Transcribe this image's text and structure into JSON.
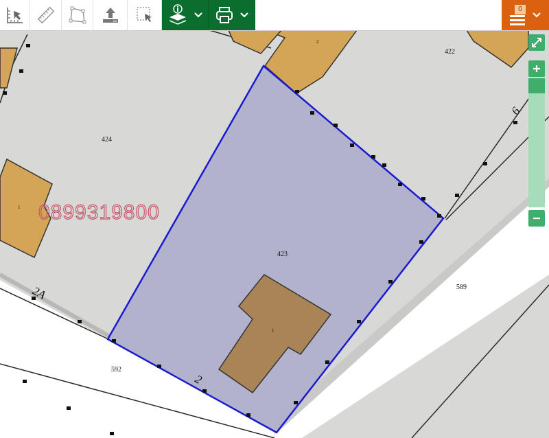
{
  "parcels": {
    "p424": "424",
    "p423": "423",
    "p422": "422",
    "p589": "589",
    "p592": "592"
  },
  "building_labels": {
    "b1_main": "1",
    "b1_left": "1",
    "b2_top": "2"
  },
  "street_numbers": {
    "n2a": "2A",
    "n2": "2",
    "n6": "6"
  },
  "watermark": "0899319800",
  "toolbar": {
    "badge_count": "0"
  },
  "colors": {
    "selected_parcel_fill": "#b0b0cc",
    "selected_parcel_stroke": "#1a1ad0",
    "building": "#d4a557",
    "selected_building": "#a88457",
    "toolbar_green": "#0b6e2e",
    "toolbar_orange": "#d9610f",
    "zoom_green": "#3fae6b",
    "watermark": "#c8556a"
  },
  "icons": [
    "coordinates-icon",
    "ruler-icon",
    "polygon-measure-icon",
    "upload-icon",
    "select-area-icon",
    "layers-info-icon",
    "chevron-down-icon",
    "print-icon",
    "chevron-down-icon",
    "menu-icon",
    "expand-icon",
    "zoom-in-icon",
    "zoom-out-icon"
  ]
}
